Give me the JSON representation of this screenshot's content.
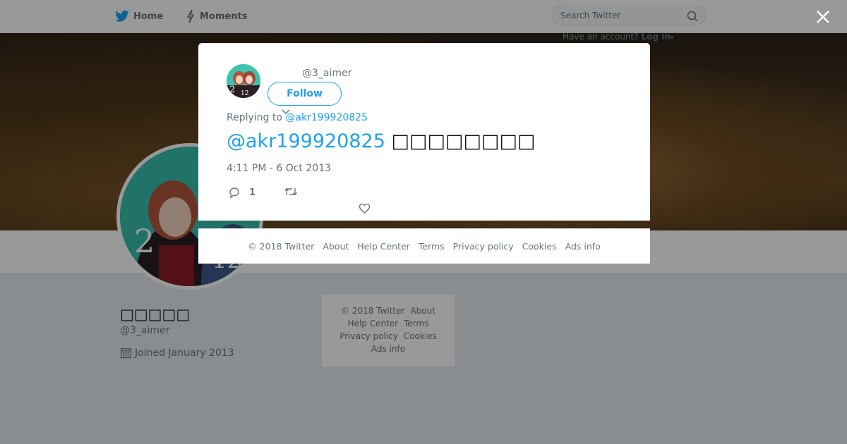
{
  "nav": {
    "home_label": "Home",
    "moments_label": "Moments",
    "search_placeholder": "Search Twitter",
    "account_prompt": "Have an account?",
    "login_label": "Log in"
  },
  "profile": {
    "name": "□□□□□",
    "handle": "@3_aimer",
    "joined": "Joined January 2013"
  },
  "sidebar_footer": {
    "copyright": "© 2018 Twitter",
    "about": "About",
    "help": "Help Center",
    "terms": "Terms",
    "privacy": "Privacy policy",
    "cookies": "Cookies",
    "ads": "Ads info"
  },
  "tweet": {
    "handle": "@3_aimer",
    "follow_label": "Follow",
    "replying_prefix": "Replying to",
    "replying_to": "@akr199920825",
    "mention": "@akr199920825",
    "text": "□□□□□□□□",
    "timestamp": "4:11 PM - 6 Oct 2013",
    "reply_count": "1"
  },
  "modal_footer": {
    "copyright": "© 2018 Twitter",
    "about": "About",
    "help": "Help Center",
    "terms": "Terms",
    "privacy": "Privacy policy",
    "cookies": "Cookies",
    "ads": "Ads info"
  },
  "colors": {
    "brand_blue": "#1da1f2",
    "text_gray": "#66757f",
    "overlay": "rgba(0,0,0,0.4)"
  },
  "icons": [
    "twitter-bird-icon",
    "lightning-icon",
    "search-icon",
    "calendar-icon",
    "close-icon",
    "reply-icon",
    "retweet-icon",
    "heart-icon",
    "caret-down-icon"
  ]
}
